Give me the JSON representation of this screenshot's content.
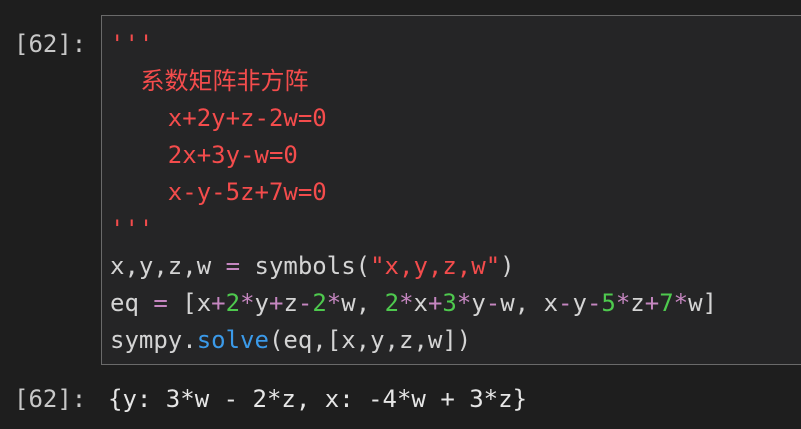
{
  "input_prompt": "[62]:",
  "output_prompt": "[62]:",
  "code": {
    "docstring_open": "'''",
    "doc_line1": "    系数矩阵非方阵",
    "doc_line2": "    x+2y+z-2w=0",
    "doc_line3": "    2x+3y-w=0",
    "doc_line4": "    x-y-5z+7w=0",
    "docstring_close": "'''",
    "line7": {
      "vars": "x,y,z,w ",
      "assign": "=",
      "func": " symbols(",
      "arg": "\"x,y,z,w\"",
      "close": ")"
    },
    "line8": {
      "lhs": "eq ",
      "assign": "=",
      "t1": " [x",
      "p1": "+",
      "n1": "2",
      "m1": "*",
      "t2": "y",
      "p2": "+",
      "t3": "z",
      "mi1": "-",
      "n2": "2",
      "m2": "*",
      "t4": "w, ",
      "n3": "2",
      "m3": "*",
      "t5": "x",
      "p3": "+",
      "n4": "3",
      "m4": "*",
      "t6": "y",
      "mi2": "-",
      "t7": "w, x",
      "mi3": "-",
      "t8": "y",
      "mi4": "-",
      "n5": "5",
      "m5": "*",
      "t9": "z",
      "p4": "+",
      "n6": "7",
      "m6": "*",
      "t10": "w]"
    },
    "line9": {
      "mod": "sympy",
      "dot": ".",
      "method": "solve",
      "args": "(eq,[x,y,z,w])"
    }
  },
  "output": "{y: 3*w - 2*z, x: -4*w + 3*z}",
  "colors": {
    "background": "#1e1e1e",
    "cell_background": "#252526",
    "string": "#f44c4c",
    "operator": "#c586c0",
    "number": "#4ec94e",
    "method": "#3b9ae9",
    "text": "#d4d4d4"
  }
}
